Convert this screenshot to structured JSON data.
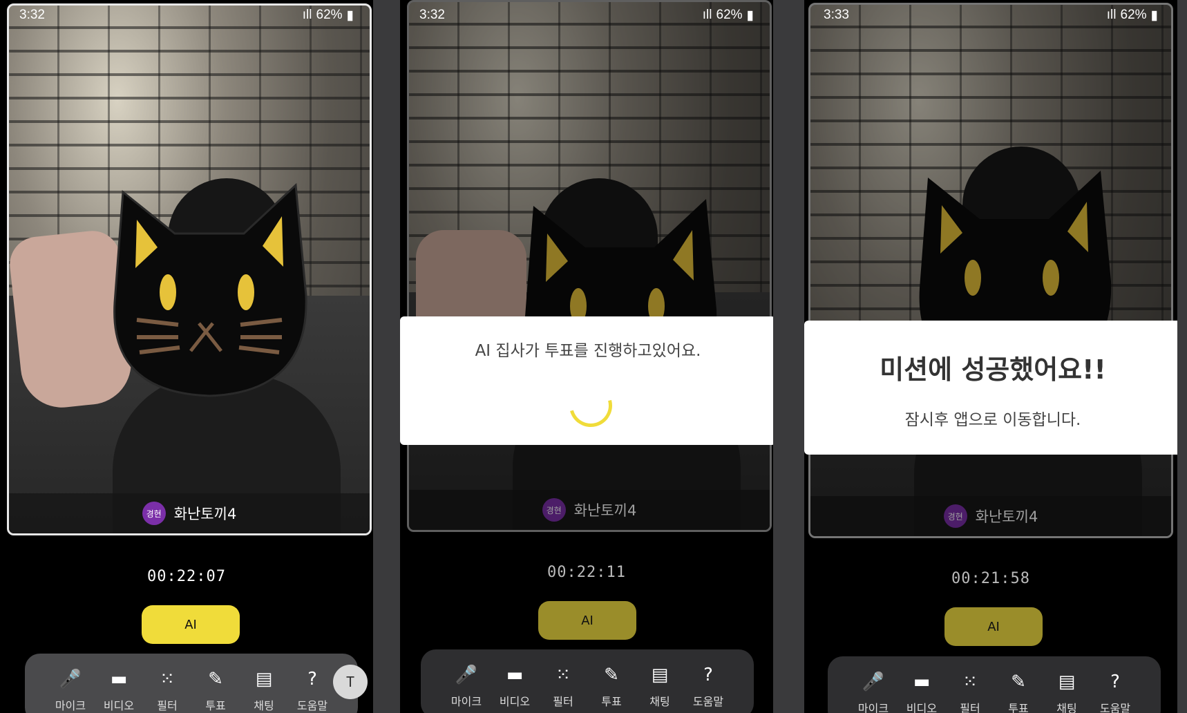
{
  "screens": [
    {
      "status": {
        "time": "3:32",
        "battery": "62%"
      },
      "username": "화난토끼4",
      "avatar_text": "경현",
      "timer": "00:22:07",
      "ai_label": "AI"
    },
    {
      "status": {
        "time": "3:32",
        "battery": "62%"
      },
      "username": "화난토끼4",
      "avatar_text": "경현",
      "timer": "00:22:11",
      "ai_label": "AI",
      "dialog_message": "AI 집사가 투표를 진행하고있어요."
    },
    {
      "status": {
        "time": "3:33",
        "battery": "62%"
      },
      "username": "화난토끼4",
      "avatar_text": "경현",
      "timer": "00:21:58",
      "ai_label": "AI",
      "dialog_title": "미션에 성공했어요!!",
      "dialog_sub": "잠시후 앱으로 이동합니다."
    }
  ],
  "toolbar": [
    {
      "icon": "mic-icon",
      "glyph": "🎤",
      "label": "마이크"
    },
    {
      "icon": "video-icon",
      "glyph": "▬",
      "label": "비디오"
    },
    {
      "icon": "filter-icon",
      "glyph": "⁙",
      "label": "필터"
    },
    {
      "icon": "vote-icon",
      "glyph": "✎",
      "label": "투표"
    },
    {
      "icon": "chat-icon",
      "glyph": "▤",
      "label": "채팅"
    },
    {
      "icon": "help-icon",
      "glyph": "?",
      "label": "도움말"
    }
  ],
  "text_fab_glyph": "T",
  "colors": {
    "accent": "#f0dc3a",
    "avatar": "#7b2fa8"
  }
}
